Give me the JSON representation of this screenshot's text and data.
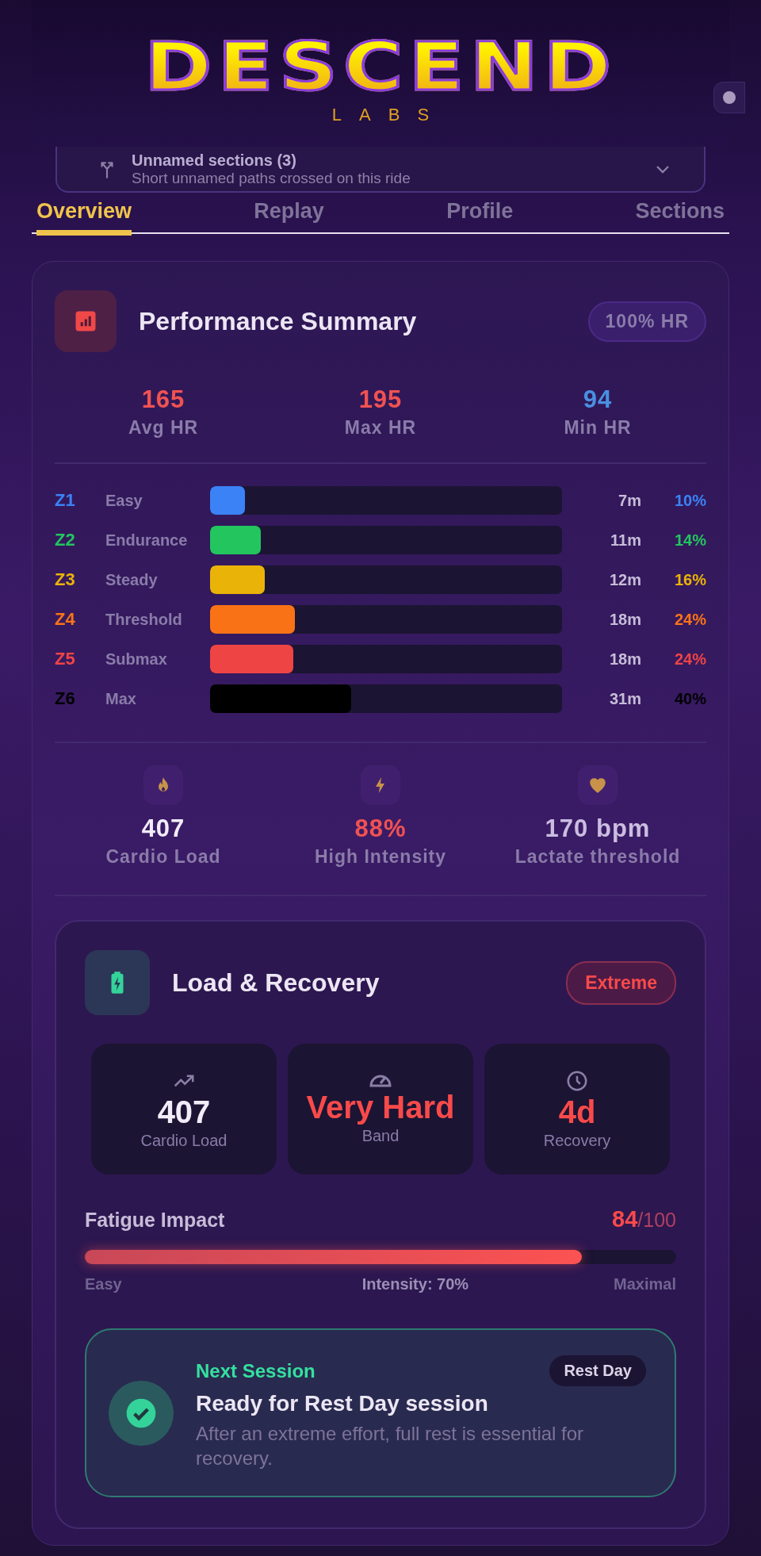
{
  "logo": {
    "name": "DESCEND",
    "tagline": "LABS"
  },
  "sections_card": {
    "title": "Unnamed sections (3)",
    "subtitle": "Short unnamed paths crossed on this ride"
  },
  "tabs": [
    {
      "label": "Overview",
      "selected": true
    },
    {
      "label": "Replay",
      "selected": false
    },
    {
      "label": "Profile",
      "selected": false
    },
    {
      "label": "Sections",
      "selected": false
    }
  ],
  "summary": {
    "title": "Performance Summary",
    "badge": "100% HR",
    "stats": [
      {
        "value": "165",
        "label": "Avg HR",
        "color": "#f05252"
      },
      {
        "value": "195",
        "label": "Max HR",
        "color": "#f05252"
      },
      {
        "value": "94",
        "label": "Min HR",
        "color": "#4a90e2"
      }
    ],
    "zones": [
      {
        "code": "Z1",
        "name": "Easy",
        "time": "7m",
        "percent": "10%",
        "level": 0.1,
        "color": "#3b82f6"
      },
      {
        "code": "Z2",
        "name": "Endurance",
        "time": "11m",
        "percent": "14%",
        "level": 0.144,
        "color": "#22c55e"
      },
      {
        "code": "Z3",
        "name": "Steady",
        "time": "12m",
        "percent": "16%",
        "level": 0.155,
        "color": "#eab308"
      },
      {
        "code": "Z4",
        "name": "Threshold",
        "time": "18m",
        "percent": "24%",
        "level": 0.24,
        "color": "#f97316"
      },
      {
        "code": "Z5",
        "name": "Submax",
        "time": "18m",
        "percent": "24%",
        "level": 0.237,
        "color": "#ef4444"
      },
      {
        "code": "Z6",
        "name": "Max",
        "time": "31m",
        "percent": "40%",
        "level": 0.4,
        "color": "#000000"
      }
    ],
    "metrics": [
      {
        "value": "407",
        "label": "Cardio Load",
        "color": "#f1ecf7"
      },
      {
        "value": "88%",
        "label": "High Intensity",
        "color": "#f05252"
      },
      {
        "value": "170 bpm",
        "label": "Lactate threshold",
        "color": "#cbbde0"
      }
    ]
  },
  "load_recovery": {
    "title": "Load & Recovery",
    "badge": "Extreme",
    "tiles": [
      {
        "value": "407",
        "label": "Cardio Load",
        "color": "#f1ecf7"
      },
      {
        "value": "Very Hard",
        "label": "Band",
        "color": "#f84a4a"
      },
      {
        "value": "4d",
        "label": "Recovery",
        "color": "#f84a4a"
      }
    ],
    "fatigue": {
      "label": "Fatigue Impact",
      "score": "84",
      "max": "/100",
      "level": 0.84,
      "left": "Easy",
      "middle": "Intensity: 70%",
      "right": "Maximal"
    },
    "next_session": {
      "eyebrow": "Next Session",
      "tag": "Rest Day",
      "title": "Ready for Rest Day session",
      "text": "After an extreme effort, full rest is essential for recovery."
    }
  }
}
